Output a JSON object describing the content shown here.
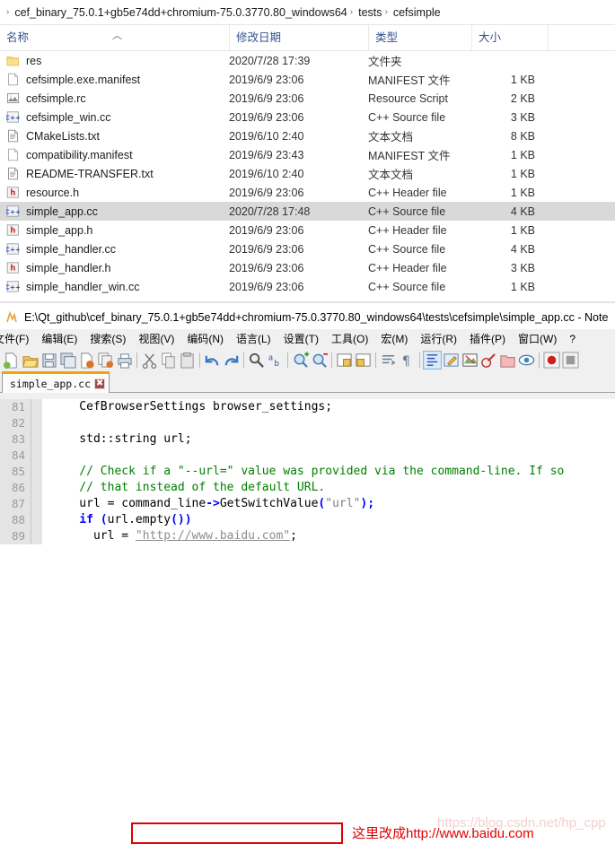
{
  "explorer": {
    "breadcrumb": {
      "items": [
        "cef_binary_75.0.1+gb5e74dd+chromium-75.0.3770.80_windows64",
        "tests",
        "cefsimple"
      ],
      "separator": "›"
    },
    "columns": {
      "name": "名称",
      "date": "修改日期",
      "type": "类型",
      "size": "大小",
      "sort_arrow": "︿"
    },
    "files": [
      {
        "icon": "folder-icon",
        "name": "res",
        "date": "2020/7/28 17:39",
        "type": "文件夹",
        "size": "",
        "selected": false
      },
      {
        "icon": "blank-doc-icon",
        "name": "cefsimple.exe.manifest",
        "date": "2019/6/9 23:06",
        "type": "MANIFEST 文件",
        "size": "1 KB",
        "selected": false
      },
      {
        "icon": "image-doc-icon",
        "name": "cefsimple.rc",
        "date": "2019/6/9 23:06",
        "type": "Resource Script",
        "size": "2 KB",
        "selected": false
      },
      {
        "icon": "cpp-source-icon",
        "name": "cefsimple_win.cc",
        "date": "2019/6/9 23:06",
        "type": "C++ Source file",
        "size": "3 KB",
        "selected": false
      },
      {
        "icon": "text-doc-icon",
        "name": "CMakeLists.txt",
        "date": "2019/6/10 2:40",
        "type": "文本文档",
        "size": "8 KB",
        "selected": false
      },
      {
        "icon": "blank-doc-icon",
        "name": "compatibility.manifest",
        "date": "2019/6/9 23:43",
        "type": "MANIFEST 文件",
        "size": "1 KB",
        "selected": false
      },
      {
        "icon": "text-doc-icon",
        "name": "README-TRANSFER.txt",
        "date": "2019/6/10 2:40",
        "type": "文本文档",
        "size": "1 KB",
        "selected": false
      },
      {
        "icon": "header-icon",
        "name": "resource.h",
        "date": "2019/6/9 23:06",
        "type": "C++ Header file",
        "size": "1 KB",
        "selected": false
      },
      {
        "icon": "cpp-source-icon",
        "name": "simple_app.cc",
        "date": "2020/7/28 17:48",
        "type": "C++ Source file",
        "size": "4 KB",
        "selected": true
      },
      {
        "icon": "header-icon",
        "name": "simple_app.h",
        "date": "2019/6/9 23:06",
        "type": "C++ Header file",
        "size": "1 KB",
        "selected": false
      },
      {
        "icon": "cpp-source-icon",
        "name": "simple_handler.cc",
        "date": "2019/6/9 23:06",
        "type": "C++ Source file",
        "size": "4 KB",
        "selected": false
      },
      {
        "icon": "header-icon",
        "name": "simple_handler.h",
        "date": "2019/6/9 23:06",
        "type": "C++ Header file",
        "size": "3 KB",
        "selected": false
      },
      {
        "icon": "cpp-source-icon",
        "name": "simple_handler_win.cc",
        "date": "2019/6/9 23:06",
        "type": "C++ Source file",
        "size": "1 KB",
        "selected": false
      }
    ]
  },
  "notepad": {
    "title": "E:\\Qt_github\\cef_binary_75.0.1+gb5e74dd+chromium-75.0.3770.80_windows64\\tests\\cefsimple\\simple_app.cc - Note",
    "menu": [
      "文件(F)",
      "编辑(E)",
      "搜索(S)",
      "视图(V)",
      "编码(N)",
      "语言(L)",
      "设置(T)",
      "工具(O)",
      "宏(M)",
      "运行(R)",
      "插件(P)",
      "窗口(W)",
      "?"
    ],
    "toolbar": [
      "new-file-icon",
      "open-file-icon",
      "save-icon",
      "save-all-icon",
      "close-file-icon",
      "close-all-icon",
      "print-icon",
      "sep",
      "cut-icon",
      "copy-icon",
      "paste-icon",
      "sep",
      "undo-icon",
      "redo-icon",
      "sep",
      "find-icon",
      "replace-icon",
      "sep",
      "zoom-in-icon",
      "zoom-out-icon",
      "sep",
      "sync-v-scroll-icon",
      "sync-h-scroll-icon",
      "sep",
      "word-wrap-icon",
      "show-all-chars-icon",
      "sep",
      "indent-guide-icon",
      "user-lang-icon",
      "doc-map-icon",
      "function-list-icon",
      "folder-workspace-icon",
      "monitor-icon",
      "sep",
      "record-macro-icon",
      "stop-macro-icon"
    ],
    "tab": {
      "label": "simple_app.cc",
      "close": "✖"
    },
    "annotation": "这里改成http://www.baidu.com",
    "watermark": "https://blog.csdn.net/hp_cpp",
    "code_lines": [
      {
        "num": "81",
        "segments": [
          {
            "t": "    CefBrowserSettings browser_settings;",
            "c": "plain"
          }
        ]
      },
      {
        "num": "82",
        "segments": [
          {
            "t": "",
            "c": "plain"
          }
        ]
      },
      {
        "num": "83",
        "segments": [
          {
            "t": "    std::string url;",
            "c": "plain"
          }
        ]
      },
      {
        "num": "84",
        "segments": [
          {
            "t": "",
            "c": "plain"
          }
        ]
      },
      {
        "num": "85",
        "segments": [
          {
            "t": "    // Check if a \"--url=\" value was provided via the command-line. If so",
            "c": "comment"
          }
        ]
      },
      {
        "num": "86",
        "segments": [
          {
            "t": "    // that instead of the default URL.",
            "c": "comment"
          }
        ]
      },
      {
        "num": "87",
        "segments": [
          {
            "t": "    url = command_line",
            "c": "plain"
          },
          {
            "t": "->",
            "c": "operator"
          },
          {
            "t": "GetSwitchValue",
            "c": "plain"
          },
          {
            "t": "(",
            "c": "operator"
          },
          {
            "t": "\"url\"",
            "c": "string"
          },
          {
            "t": ");",
            "c": "operator"
          }
        ]
      },
      {
        "num": "88",
        "segments": [
          {
            "t": "    ",
            "c": "plain"
          },
          {
            "t": "if",
            "c": "keyword"
          },
          {
            "t": " ",
            "c": "plain"
          },
          {
            "t": "(",
            "c": "operator"
          },
          {
            "t": "url.empty",
            "c": "plain"
          },
          {
            "t": "())",
            "c": "operator"
          }
        ]
      },
      {
        "num": "89",
        "segments": [
          {
            "t": "      url = ",
            "c": "plain"
          },
          {
            "t": "\"http://www.baidu.com\"",
            "c": "string-url"
          },
          {
            "t": ";",
            "c": "plain"
          }
        ]
      }
    ]
  }
}
